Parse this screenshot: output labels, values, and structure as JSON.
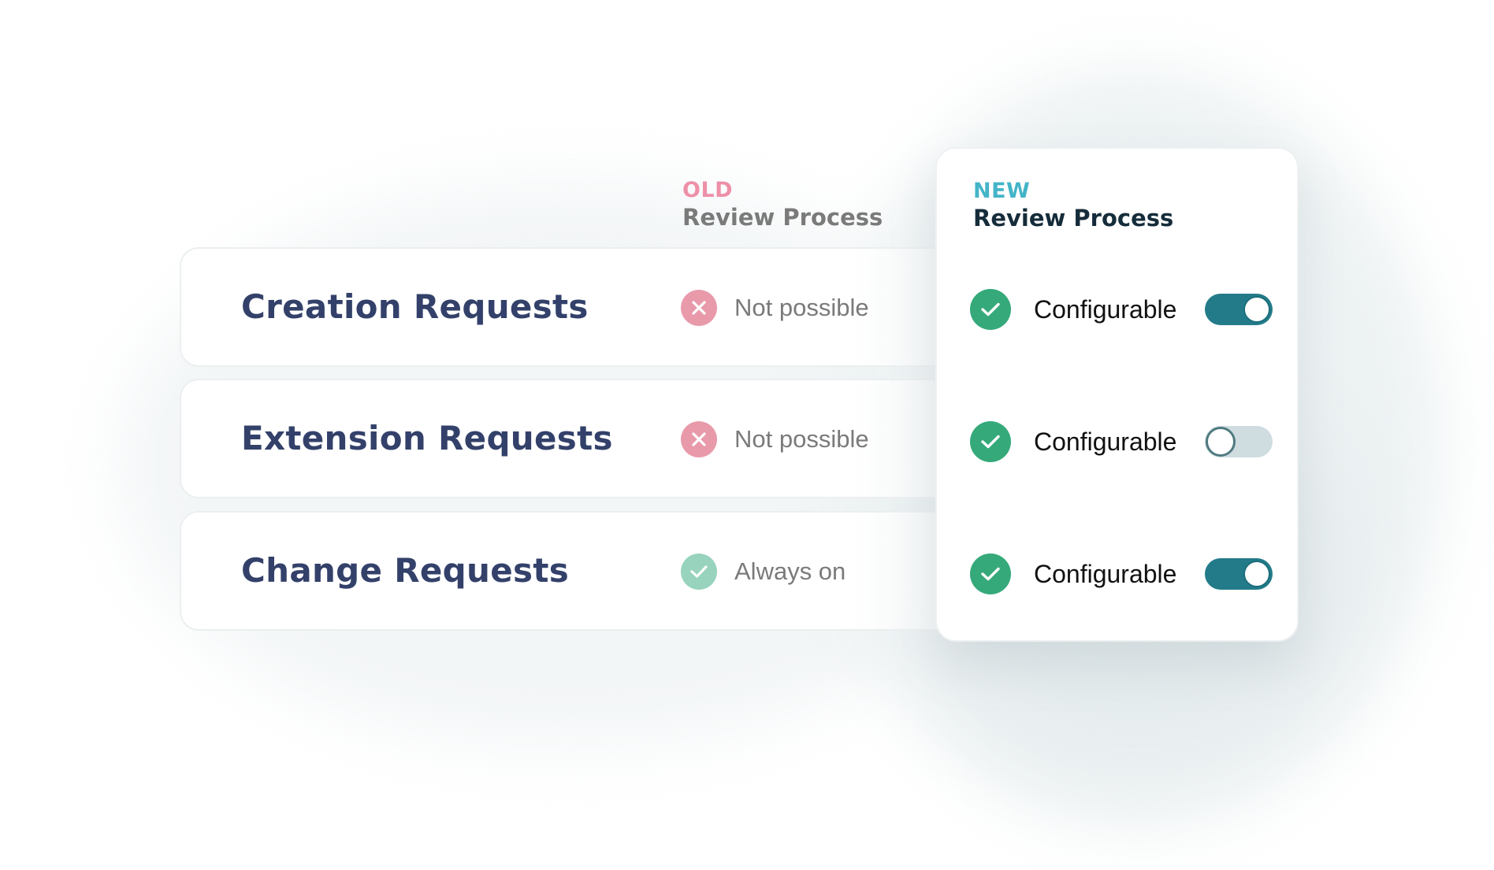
{
  "old_column": {
    "tag": "OLD",
    "title": "Review Process",
    "tag_color": "#ee8fa8"
  },
  "new_column": {
    "tag": "NEW",
    "title": "Review Process",
    "tag_color": "#44b4c8"
  },
  "rows": [
    {
      "label": "Creation Requests",
      "old_status": {
        "icon": "x-circle-icon",
        "text": "Not possible"
      },
      "new_status": {
        "icon": "check-circle-icon",
        "text": "Configurable",
        "toggle_on": true
      }
    },
    {
      "label": "Extension Requests",
      "old_status": {
        "icon": "x-circle-icon",
        "text": "Not possible"
      },
      "new_status": {
        "icon": "check-circle-icon",
        "text": "Configurable",
        "toggle_on": false
      }
    },
    {
      "label": "Change Requests",
      "old_status": {
        "icon": "check-circle-icon",
        "text": "Always on"
      },
      "new_status": {
        "icon": "check-circle-icon",
        "text": "Configurable",
        "toggle_on": true
      }
    }
  ],
  "colors": {
    "label": "#33416a",
    "not_possible": "#e89aab",
    "always_on": "#97d3bd",
    "configurable": "#35a97a",
    "toggle_on": "#237b89",
    "toggle_off": "#cfdde1"
  }
}
